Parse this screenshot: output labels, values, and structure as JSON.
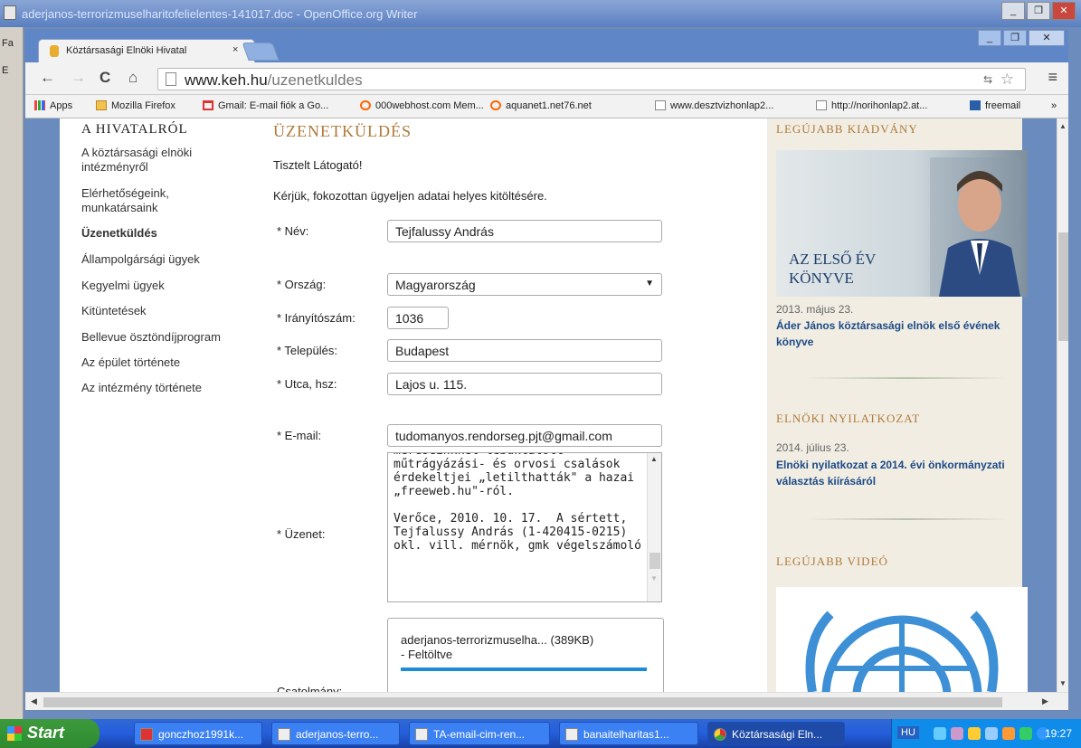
{
  "outer_window": {
    "title": "aderjanos-terrorizmuselharitofelielentes-141017.doc - OpenOffice.org Writer",
    "left_chars": [
      "Fa",
      "E",
      "E"
    ]
  },
  "browser": {
    "tab_title": "Köztársasági Elnöki Hivatal",
    "tab_close": "×",
    "url_host": "www.keh.hu",
    "url_path": "/uzenetkuldes",
    "bookmarks": [
      {
        "label": "Apps",
        "icon": "apps-icon"
      },
      {
        "label": "Mozilla Firefox",
        "icon": "folder-icon"
      },
      {
        "label": "Gmail: E-mail fiók a Go...",
        "icon": "gmail-icon"
      },
      {
        "label": "000webhost.com Mem...",
        "icon": "webhost-icon"
      },
      {
        "label": "aquanet1.net76.net",
        "icon": "webhost-icon"
      },
      {
        "label": "www.desztvizhonlap2...",
        "icon": "page-icon"
      },
      {
        "label": "http://norihonlap2.at...",
        "icon": "page-icon"
      },
      {
        "label": "freemail",
        "icon": "freemail-icon"
      }
    ],
    "bookmarks_more": "»"
  },
  "site": {
    "sidebar": {
      "heading": "A HIVATALRÓL",
      "items": [
        {
          "label": "A köztársasági elnöki intézményről",
          "active": false
        },
        {
          "label": "Elérhetőségeink, munkatársaink",
          "active": false
        },
        {
          "label": "Üzenetküldés",
          "active": true
        },
        {
          "label": "Állampolgársági ügyek",
          "active": false
        },
        {
          "label": "Kegyelmi ügyek",
          "active": false
        },
        {
          "label": "Kitüntetések",
          "active": false
        },
        {
          "label": "Bellevue ösztöndíjprogram",
          "active": false
        },
        {
          "label": "Az épület története",
          "active": false
        },
        {
          "label": "Az intézmény története",
          "active": false
        }
      ]
    },
    "main": {
      "heading": "ÜZENETKÜLDÉS",
      "greeting": "Tisztelt Látogató!",
      "instruction": "Kérjük, fokozottan ügyeljen adatai helyes kitöltésére.",
      "form": {
        "name_label": "* Név:",
        "name_value": "Tejfalussy András",
        "country_label": "* Ország:",
        "country_value": "Magyarország",
        "zip_label": "* Irányítószám:",
        "zip_value": "1036",
        "city_label": "* Település:",
        "city_value": "Budapest",
        "street_label": "* Utca, hsz:",
        "street_value": "Lajos u. 115.",
        "email_label": "* E-mail:",
        "email_value": "tudomanyos.rendorseg.pjt@gmail.com",
        "message_label": "* Üzenet:",
        "message_value": "méréseinkkel lebuktatott műtrágyázási- és orvosi csalások érdekeltjei „letilthatták\" a hazai „freeweb.hu\"-ról.\n\nVerőce, 2010. 10. 17.  A sértett, Tejfalussy András (1-420415-0215) okl. vill. mérnök, gmk végelszámoló",
        "attachment_label": "Csatolmány:",
        "attachment_name": "aderjanos-terrorizmuselha... (389KB)",
        "attachment_status": "- Feltöltve"
      }
    },
    "right": {
      "pub_heading": "LEGÚJABB KIADVÁNY",
      "pub_caption_1": "AZ ELSŐ ÉV",
      "pub_caption_2": "KÖNYVE",
      "pub_date": "2013. május 23.",
      "pub_link": "Áder János köztársasági elnök első évének könyve",
      "decl_heading": "ELNÖKI NYILATKOZAT",
      "decl_date": "2014. július 23.",
      "decl_link": "Elnöki nyilatkozat a 2014. évi önkormányzati választás kiírásáról",
      "video_heading": "LEGÚJABB VIDEÓ"
    }
  },
  "taskbar": {
    "start": "Start",
    "items": [
      {
        "label": "gonczhoz1991k...",
        "active": false
      },
      {
        "label": "aderjanos-terro...",
        "active": false
      },
      {
        "label": "TA-email-cim-ren...",
        "active": false
      },
      {
        "label": "banaitelharitas1...",
        "active": false
      },
      {
        "label": "Köztársasági Eln...",
        "active": true
      }
    ],
    "lang": "HU",
    "clock": "19:27"
  }
}
